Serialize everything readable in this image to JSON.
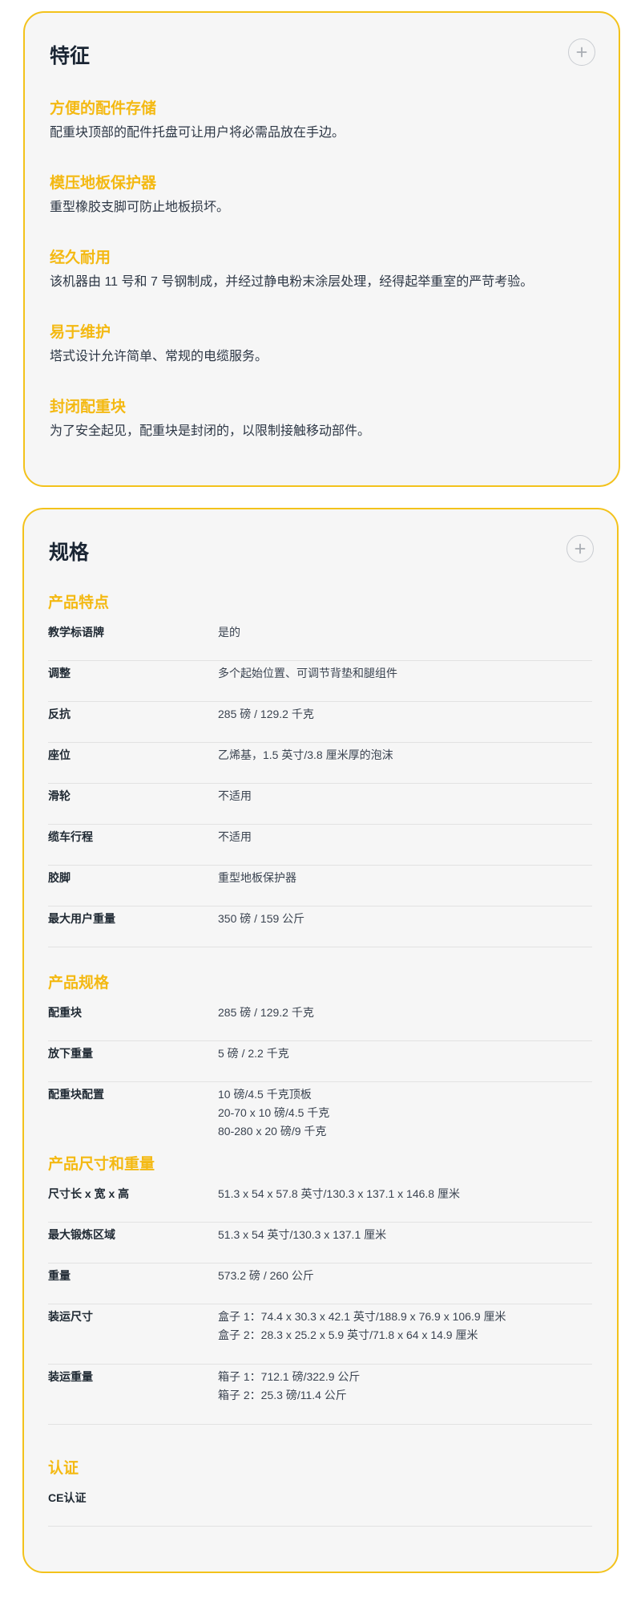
{
  "features": {
    "title": "特征",
    "items": [
      {
        "title": "方便的配件存储",
        "desc": "配重块顶部的配件托盘可让用户将必需品放在手边。"
      },
      {
        "title": "模压地板保护器",
        "desc": "重型橡胶支脚可防止地板损坏。"
      },
      {
        "title": "经久耐用",
        "desc": "该机器由 11 号和 7 号钢制成，并经过静电粉末涂层处理，经得起举重室的严苛考验。"
      },
      {
        "title": "易于维护",
        "desc": "塔式设计允许简单、常规的电缆服务。"
      },
      {
        "title": "封闭配重块",
        "desc": "为了安全起见，配重块是封闭的，以限制接触移动部件。"
      }
    ]
  },
  "specs": {
    "title": "规格",
    "groups": [
      {
        "title": "产品特点",
        "rows": [
          {
            "label": "教学标语牌",
            "values": [
              "是的"
            ]
          },
          {
            "label": "调整",
            "values": [
              "多个起始位置、可调节背垫和腿组件"
            ]
          },
          {
            "label": "反抗",
            "values": [
              "285 磅 / 129.2 千克"
            ]
          },
          {
            "label": "座位",
            "values": [
              "乙烯基，1.5 英寸/3.8 厘米厚的泡沫"
            ]
          },
          {
            "label": "滑轮",
            "values": [
              "不适用"
            ]
          },
          {
            "label": "缆车行程",
            "values": [
              "不适用"
            ]
          },
          {
            "label": "胶脚",
            "values": [
              "重型地板保护器"
            ]
          },
          {
            "label": "最大用户重量",
            "values": [
              "350 磅 / 159 公斤"
            ]
          }
        ]
      },
      {
        "title": "产品规格",
        "rows": [
          {
            "label": "配重块",
            "values": [
              "285 磅 / 129.2 千克"
            ]
          },
          {
            "label": "放下重量",
            "values": [
              "5 磅 / 2.2 千克"
            ]
          },
          {
            "label": "配重块配置",
            "values": [
              "10 磅/4.5 千克顶板",
              "20-70 x 10 磅/4.5 千克",
              "80-280 x 20 磅/9 千克"
            ]
          }
        ]
      },
      {
        "title": "产品尺寸和重量",
        "rows": [
          {
            "label": "尺寸长 x 宽 x 高",
            "values": [
              "51.3 x 54 x 57.8 英寸/130.3 x 137.1 x 146.8 厘米"
            ]
          },
          {
            "label": "最大锻炼区域",
            "values": [
              "51.3 x 54 英寸/130.3 x 137.1 厘米"
            ]
          },
          {
            "label": "重量",
            "values": [
              "573.2 磅 / 260 公斤"
            ]
          },
          {
            "label": "装运尺寸",
            "values": [
              "盒子 1：74.4 x 30.3 x 42.1 英寸/188.9 x 76.9 x 106.9 厘米",
              "盒子 2：28.3 x 25.2 x 5.9 英寸/71.8 x 64 x 14.9 厘米"
            ]
          },
          {
            "label": "装运重量",
            "values": [
              "箱子 1：712.1 磅/322.9 公斤",
              "箱子 2：25.3 磅/11.4 公斤"
            ]
          }
        ]
      },
      {
        "title": "认证",
        "rows": [
          {
            "label": "CE认证",
            "values": [
              ""
            ]
          }
        ]
      }
    ]
  },
  "colors": {
    "accent": "#f4b912",
    "border": "#f3c21b",
    "card_bg": "#f6f6f6",
    "heading": "#1a2533"
  },
  "icons": {
    "toggle": "plus-icon"
  }
}
